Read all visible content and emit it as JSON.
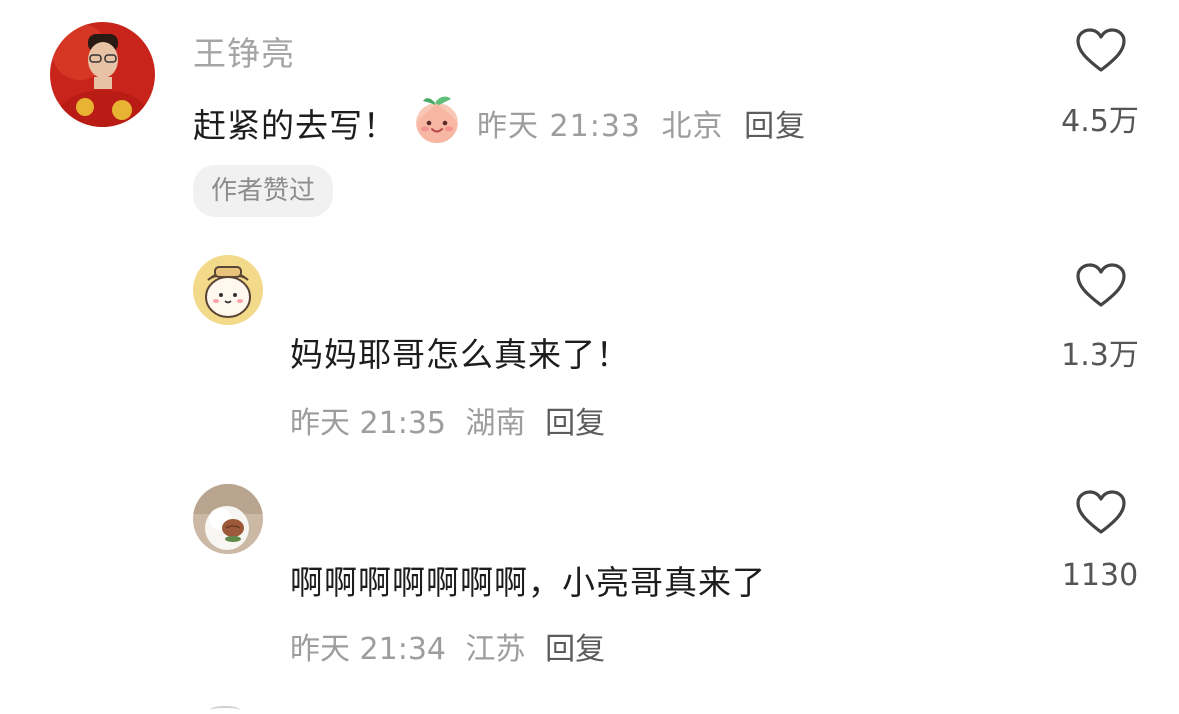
{
  "comments": [
    {
      "username": "王铮亮",
      "text": "赶紧的去写！",
      "emoji": "peach-face-icon",
      "time": "昨天 21:33",
      "location": "北京",
      "reply_label": "回复",
      "likes": "4.5万",
      "badge": "作者赞过",
      "avatar": "photo-avatar-red"
    },
    {
      "username": "",
      "text": "妈妈耶哥怎么真来了！",
      "time": "昨天 21:35",
      "location": "湖南",
      "reply_label": "回复",
      "likes": "1.3万",
      "avatar": "cartoon-avatar-yellow"
    },
    {
      "username": "",
      "text": "啊啊啊啊啊啊啊，小亮哥真来了",
      "time": "昨天 21:34",
      "location": "江苏",
      "reply_label": "回复",
      "likes": "1130",
      "avatar": "photo-avatar-white-dog"
    }
  ],
  "colors": {
    "username": "#a5a5a5",
    "meta": "#9d9d9d",
    "heart_stroke": "#444444",
    "badge_bg": "#f1f1f1"
  }
}
